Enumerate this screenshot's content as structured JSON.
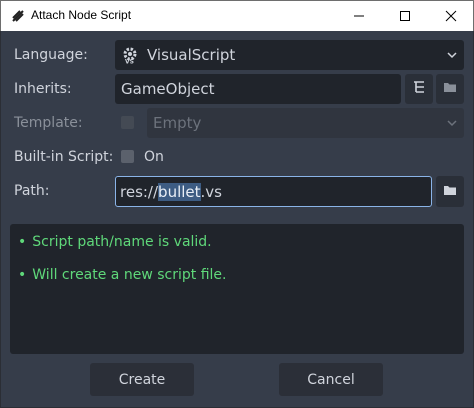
{
  "window": {
    "title": "Attach Node Script",
    "buttons": {
      "minimize": "—",
      "maximize": "☐",
      "close": "✕"
    }
  },
  "form": {
    "language": {
      "label": "Language:",
      "value": "VisualScript",
      "icon": "visualscript-gear-icon"
    },
    "inherits": {
      "label": "Inherits:",
      "value": "GameObject"
    },
    "template": {
      "label": "Template:",
      "value": "Empty",
      "enabled": false
    },
    "builtin": {
      "label": "Built-in Script:",
      "option": "On",
      "checked": false
    },
    "path": {
      "label": "Path:",
      "prefix": "res://",
      "selected": "bullet",
      "suffix": ".vs"
    }
  },
  "messages": [
    {
      "bullet": "•",
      "text": "Script path/name is valid."
    },
    {
      "bullet": "•",
      "text": "Will create a new script file."
    }
  ],
  "actions": {
    "create": "Create",
    "cancel": "Cancel"
  },
  "colors": {
    "background": "#363d4a",
    "field": "#20242b",
    "valid_message": "#5fd87a",
    "focus_border": "#8ab4e8",
    "selection": "#3d5c83"
  }
}
